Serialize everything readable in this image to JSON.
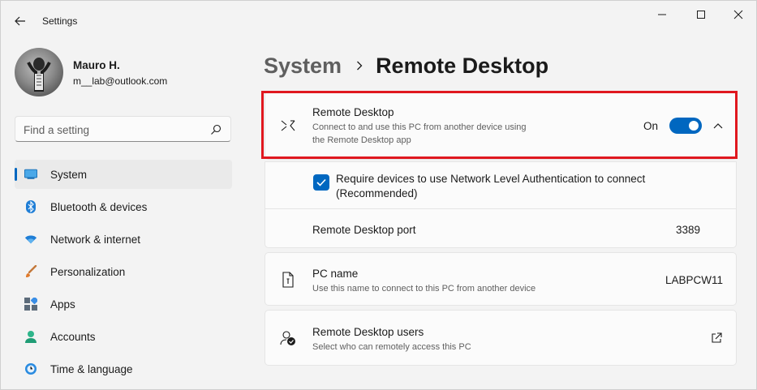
{
  "window": {
    "title": "Settings"
  },
  "profile": {
    "name": "Mauro H.",
    "email": "m__lab@outlook.com"
  },
  "search": {
    "placeholder": "Find a setting"
  },
  "nav": {
    "items": [
      {
        "label": "System",
        "icon": "system-icon",
        "active": true
      },
      {
        "label": "Bluetooth & devices",
        "icon": "bluetooth-icon"
      },
      {
        "label": "Network & internet",
        "icon": "network-icon"
      },
      {
        "label": "Personalization",
        "icon": "brush-icon"
      },
      {
        "label": "Apps",
        "icon": "apps-icon"
      },
      {
        "label": "Accounts",
        "icon": "accounts-icon"
      },
      {
        "label": "Time & language",
        "icon": "time-language-icon"
      }
    ]
  },
  "breadcrumb": {
    "parent": "System",
    "current": "Remote Desktop"
  },
  "remote_desktop": {
    "title": "Remote Desktop",
    "description_line1": "Connect to and use this PC from another device using",
    "description_line2": "the Remote Desktop app",
    "toggle_label": "On",
    "enabled": true
  },
  "nla": {
    "label_line1": "Require devices to use Network Level Authentication to connect",
    "label_line2": "(Recommended)",
    "checked": true
  },
  "port": {
    "label": "Remote Desktop port",
    "value": "3389"
  },
  "pc_name": {
    "title": "PC name",
    "description": "Use this name to connect to this PC from another device",
    "value": "LABPCW11"
  },
  "users": {
    "title": "Remote Desktop users",
    "description": "Select who can remotely access this PC"
  },
  "colors": {
    "accent": "#0067c0",
    "highlight": "#e0181f",
    "background": "#f3f3f3",
    "card": "#fbfbfb"
  }
}
